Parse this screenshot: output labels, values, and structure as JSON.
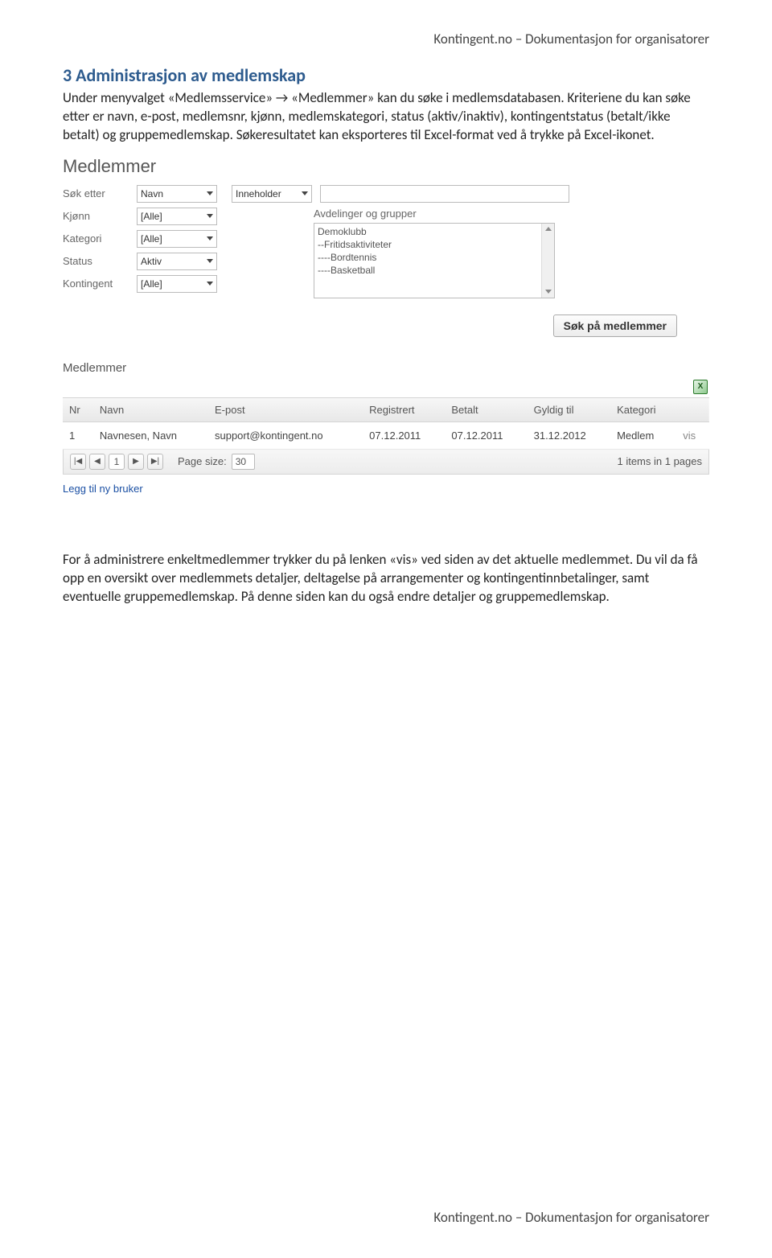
{
  "header": {
    "right_text": "Kontingent.no – Dokumentasjon for organisatorer"
  },
  "footer": {
    "right_text": "Kontingent.no – Dokumentasjon for organisatorer"
  },
  "section": {
    "heading": "3 Administrasjon av medlemskap",
    "intro": "Under menyvalget «Medlemsservice» → «Medlemmer» kan du søke i medlemsdatabasen. Kriteriene du kan søke etter er navn, e-post, medlemsnr, kjønn, medlemskategori, status (aktiv/inaktiv), kontingentstatus (betalt/ikke betalt) og gruppemedlemskap. Søkeresultatet kan eksporteres til Excel-format ved å trykke på Excel-ikonet."
  },
  "app": {
    "heading1": "Medlemmer",
    "search_label": "Søk etter",
    "search_field_value": "Navn",
    "match_value": "Inneholder",
    "filters": {
      "kjonn_label": "Kjønn",
      "kategori_label": "Kategori",
      "status_label": "Status",
      "kontingent_label": "Kontingent",
      "kjonn_value": "[Alle]",
      "kategori_value": "[Alle]",
      "status_value": "Aktiv",
      "kontingent_value": "[Alle]"
    },
    "groups": {
      "label": "Avdelinger og grupper",
      "items": [
        "Demoklubb",
        "--Fritidsaktiviteter",
        "----Bordtennis",
        "----Basketball"
      ]
    },
    "search_button": "Søk på medlemmer",
    "heading2": "Medlemmer",
    "table": {
      "cols": [
        "Nr",
        "Navn",
        "E-post",
        "Registrert",
        "Betalt",
        "Gyldig til",
        "Kategori",
        ""
      ],
      "row": {
        "nr": "1",
        "navn": "Navnesen, Navn",
        "epost": "support@kontingent.no",
        "registrert": "07.12.2011",
        "betalt": "07.12.2011",
        "gyldig": "31.12.2012",
        "kategori": "Medlem",
        "vis": "vis"
      }
    },
    "pager": {
      "page": "1",
      "size_label": "Page size:",
      "size_value": "30",
      "summary": "1 items in 1 pages"
    },
    "add_link": "Legg til ny bruker",
    "icons": {
      "first": "|◀",
      "prev": "◀",
      "next": "▶",
      "last": "▶|"
    }
  },
  "outro": "For å administrere enkeltmedlemmer trykker du på lenken «vis» ved siden av det aktuelle medlemmet. Du vil da få opp en oversikt over medlemmets detaljer, deltagelse på arrangementer og kontingentinnbetalinger, samt eventuelle gruppemedlemskap. På denne siden kan du også endre detaljer og gruppemedlemskap."
}
